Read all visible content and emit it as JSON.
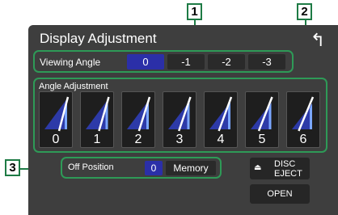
{
  "screen": {
    "title": "Display Adjustment",
    "back_icon": "return-arrow-icon"
  },
  "viewing_angle": {
    "label": "Viewing Angle",
    "options": [
      "0",
      "-1",
      "-2",
      "-3"
    ],
    "selected": "0"
  },
  "angle_adjustment": {
    "label": "Angle Adjustment",
    "options": [
      "0",
      "1",
      "2",
      "3",
      "4",
      "5",
      "6"
    ],
    "selected": "6"
  },
  "off_position": {
    "label": "Off Position",
    "value": "0",
    "memory_label": "Memory"
  },
  "disc_eject": {
    "line1": "DISC",
    "line2": "EJECT",
    "icon": "eject-icon"
  },
  "open": {
    "label": "OPEN"
  },
  "callouts": [
    "1",
    "2",
    "3"
  ],
  "colors": {
    "highlight": "#2b2fa8",
    "callout": "#1e7b45",
    "background": "#3e3e3e"
  }
}
